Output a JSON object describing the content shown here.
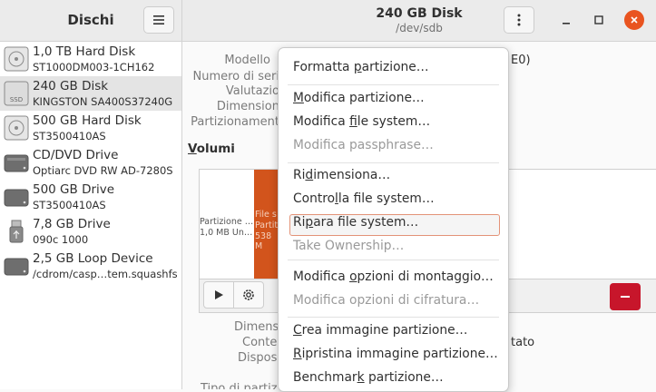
{
  "app": {
    "title": "Dischi"
  },
  "window": {
    "title": "240 GB Disk",
    "subtitle": "/dev/sdb"
  },
  "colors": {
    "accent": "#e95420",
    "partition": "#d2541c",
    "danger": "#c7162b"
  },
  "icons": {
    "hamburger": "hamburger-menu-icon",
    "kebab": "kebab-menu-icon",
    "minimize": "minimize-icon",
    "maximize": "maximize-icon",
    "close": "close-icon"
  },
  "drives": [
    {
      "name": "1,0 TB Hard Disk",
      "model": "ST1000DM003-1CH162",
      "icon": "hard-disk-icon"
    },
    {
      "name": "240 GB Disk",
      "model": "KINGSTON SA400S37240G",
      "icon": "ssd-icon"
    },
    {
      "name": "500 GB Hard Disk",
      "model": "ST3500410AS",
      "icon": "hard-disk-icon"
    },
    {
      "name": "CD/DVD Drive",
      "model": "Optiarc DVD RW AD-7280S",
      "icon": "optical-drive-icon"
    },
    {
      "name": "500 GB Drive",
      "model": "ST3500410AS",
      "icon": "drive-icon"
    },
    {
      "name": "7,8 GB Drive",
      "model": "090c 1000",
      "icon": "usb-drive-icon"
    },
    {
      "name": "2,5 GB Loop Device",
      "model": "/cdrom/casp…tem.squashfs",
      "icon": "loop-device-icon"
    }
  ],
  "properties": [
    "Modello",
    "Numero di seri",
    "Valutazio",
    "Dimension",
    "Partizionament"
  ],
  "model_tail": "E0)",
  "volumes": {
    "header": "Volumi",
    "seg1_line1": "Partizione …",
    "seg1_line2": "1,0 MB Un…",
    "seg2_line1": "File s",
    "seg2_line2": "Partiti",
    "seg2_line3": "538 M"
  },
  "lower_labels": [
    "Dimens",
    "Conte",
    "Dispos",
    "Tipo di partiz"
  ],
  "lower_value_tail": "tato",
  "menu": [
    {
      "pre": "Formatta ",
      "u": "p",
      "post": "artizione…",
      "disabled": false
    },
    {
      "pre": "",
      "u": "M",
      "post": "odifica partizione…",
      "disabled": false
    },
    {
      "pre": "Modifica ",
      "u": "f",
      "post": "ile system…",
      "disabled": false
    },
    {
      "pre": "Modifica passphrase…",
      "u": "",
      "post": "",
      "disabled": true
    },
    {
      "pre": "Ri",
      "u": "d",
      "post": "imensiona…",
      "disabled": false
    },
    {
      "pre": "Contro",
      "u": "l",
      "post": "la file system…",
      "disabled": false
    },
    {
      "pre": "Ri",
      "u": "p",
      "post": "ara file system…",
      "disabled": false
    },
    {
      "pre": "Take Ownership…",
      "u": "",
      "post": "",
      "disabled": true
    },
    {
      "pre": "Modifica ",
      "u": "o",
      "post": "pzioni di montaggio…",
      "disabled": false
    },
    {
      "pre": "Modifica opzioni di cifratura…",
      "u": "",
      "post": "",
      "disabled": true
    },
    {
      "pre": "",
      "u": "C",
      "post": "rea immagine partizione…",
      "disabled": false
    },
    {
      "pre": "",
      "u": "R",
      "post": "ipristina immagine partizione…",
      "disabled": false
    },
    {
      "pre": "Benchmar",
      "u": "k",
      "post": " partizione…",
      "disabled": false
    }
  ]
}
